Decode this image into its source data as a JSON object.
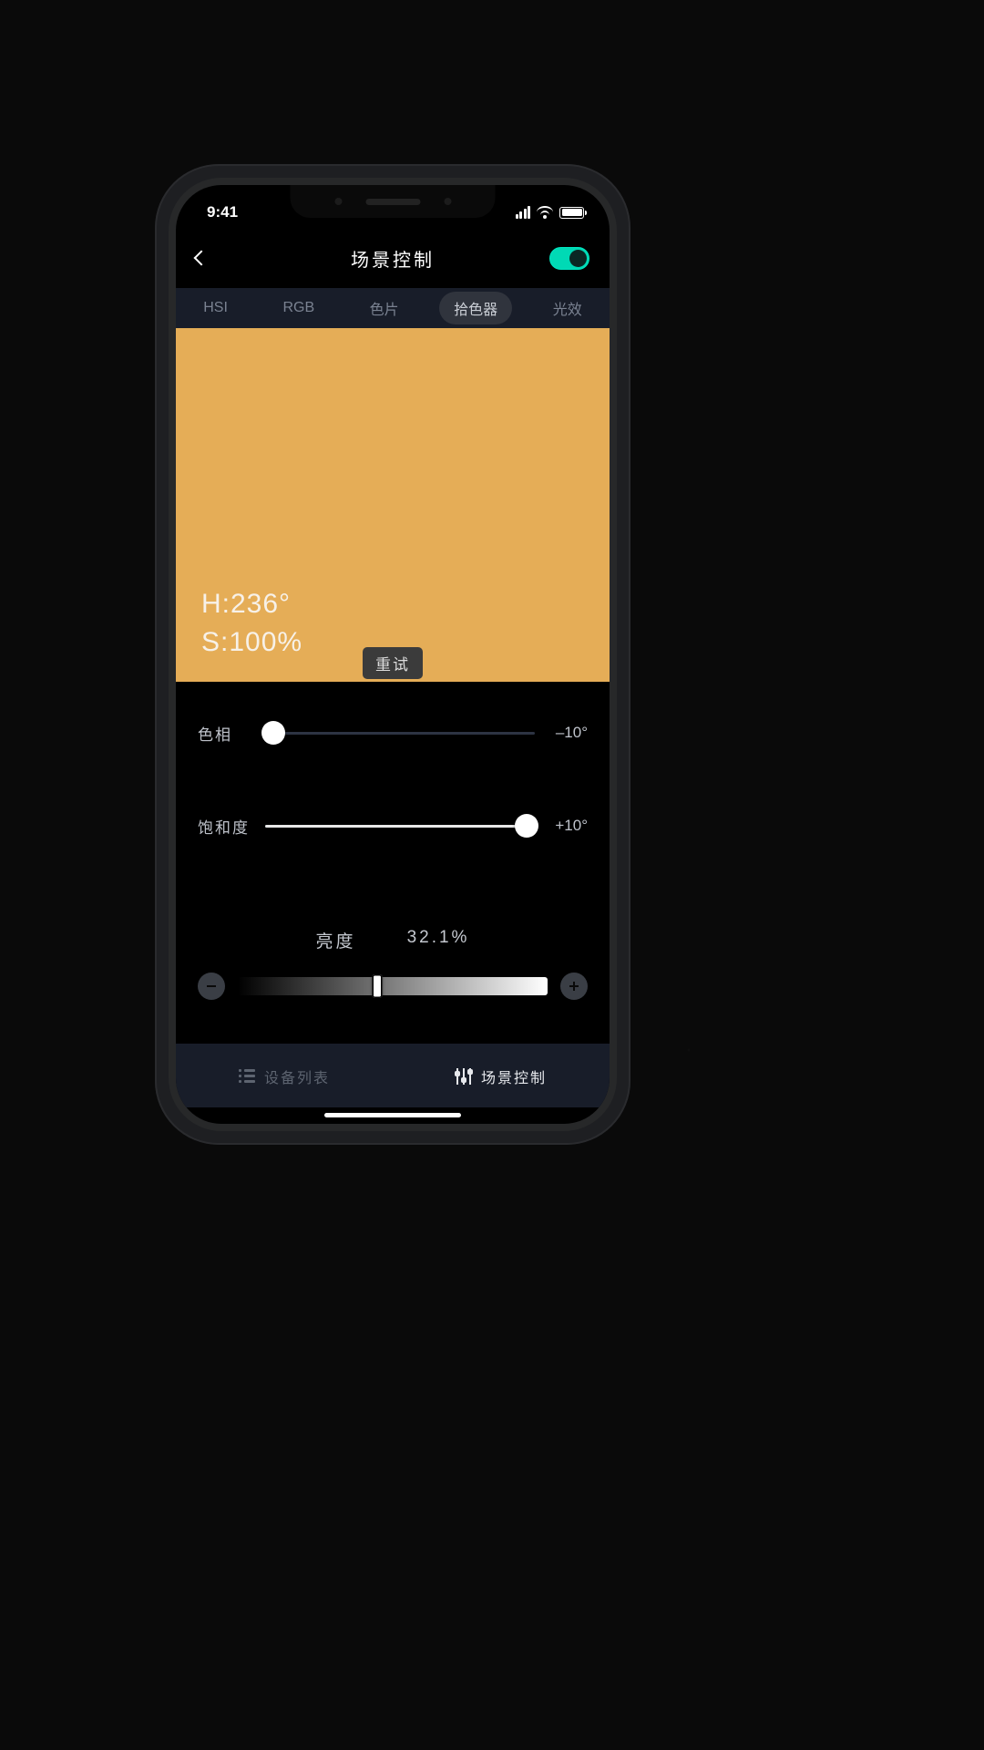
{
  "status": {
    "time": "9:41"
  },
  "header": {
    "title": "场景控制",
    "toggle_on": true
  },
  "tabs": [
    "HSI",
    "RGB",
    "色片",
    "拾色器",
    "光效"
  ],
  "active_tab_index": 3,
  "swatch": {
    "color": "#e5ad57",
    "hue_line": "H:236°",
    "sat_line": "S:100%",
    "retry_label": "重试"
  },
  "sliders": {
    "hue": {
      "label": "色相",
      "value_text": "–10°",
      "percent": 0
    },
    "sat": {
      "label": "饱和度",
      "value_text": "+10°",
      "percent": 100
    }
  },
  "brightness": {
    "label": "亮度",
    "value_text": "32.1%",
    "percent": 45
  },
  "bottom_nav": {
    "devices_label": "设备列表",
    "scene_label": "场景控制"
  }
}
